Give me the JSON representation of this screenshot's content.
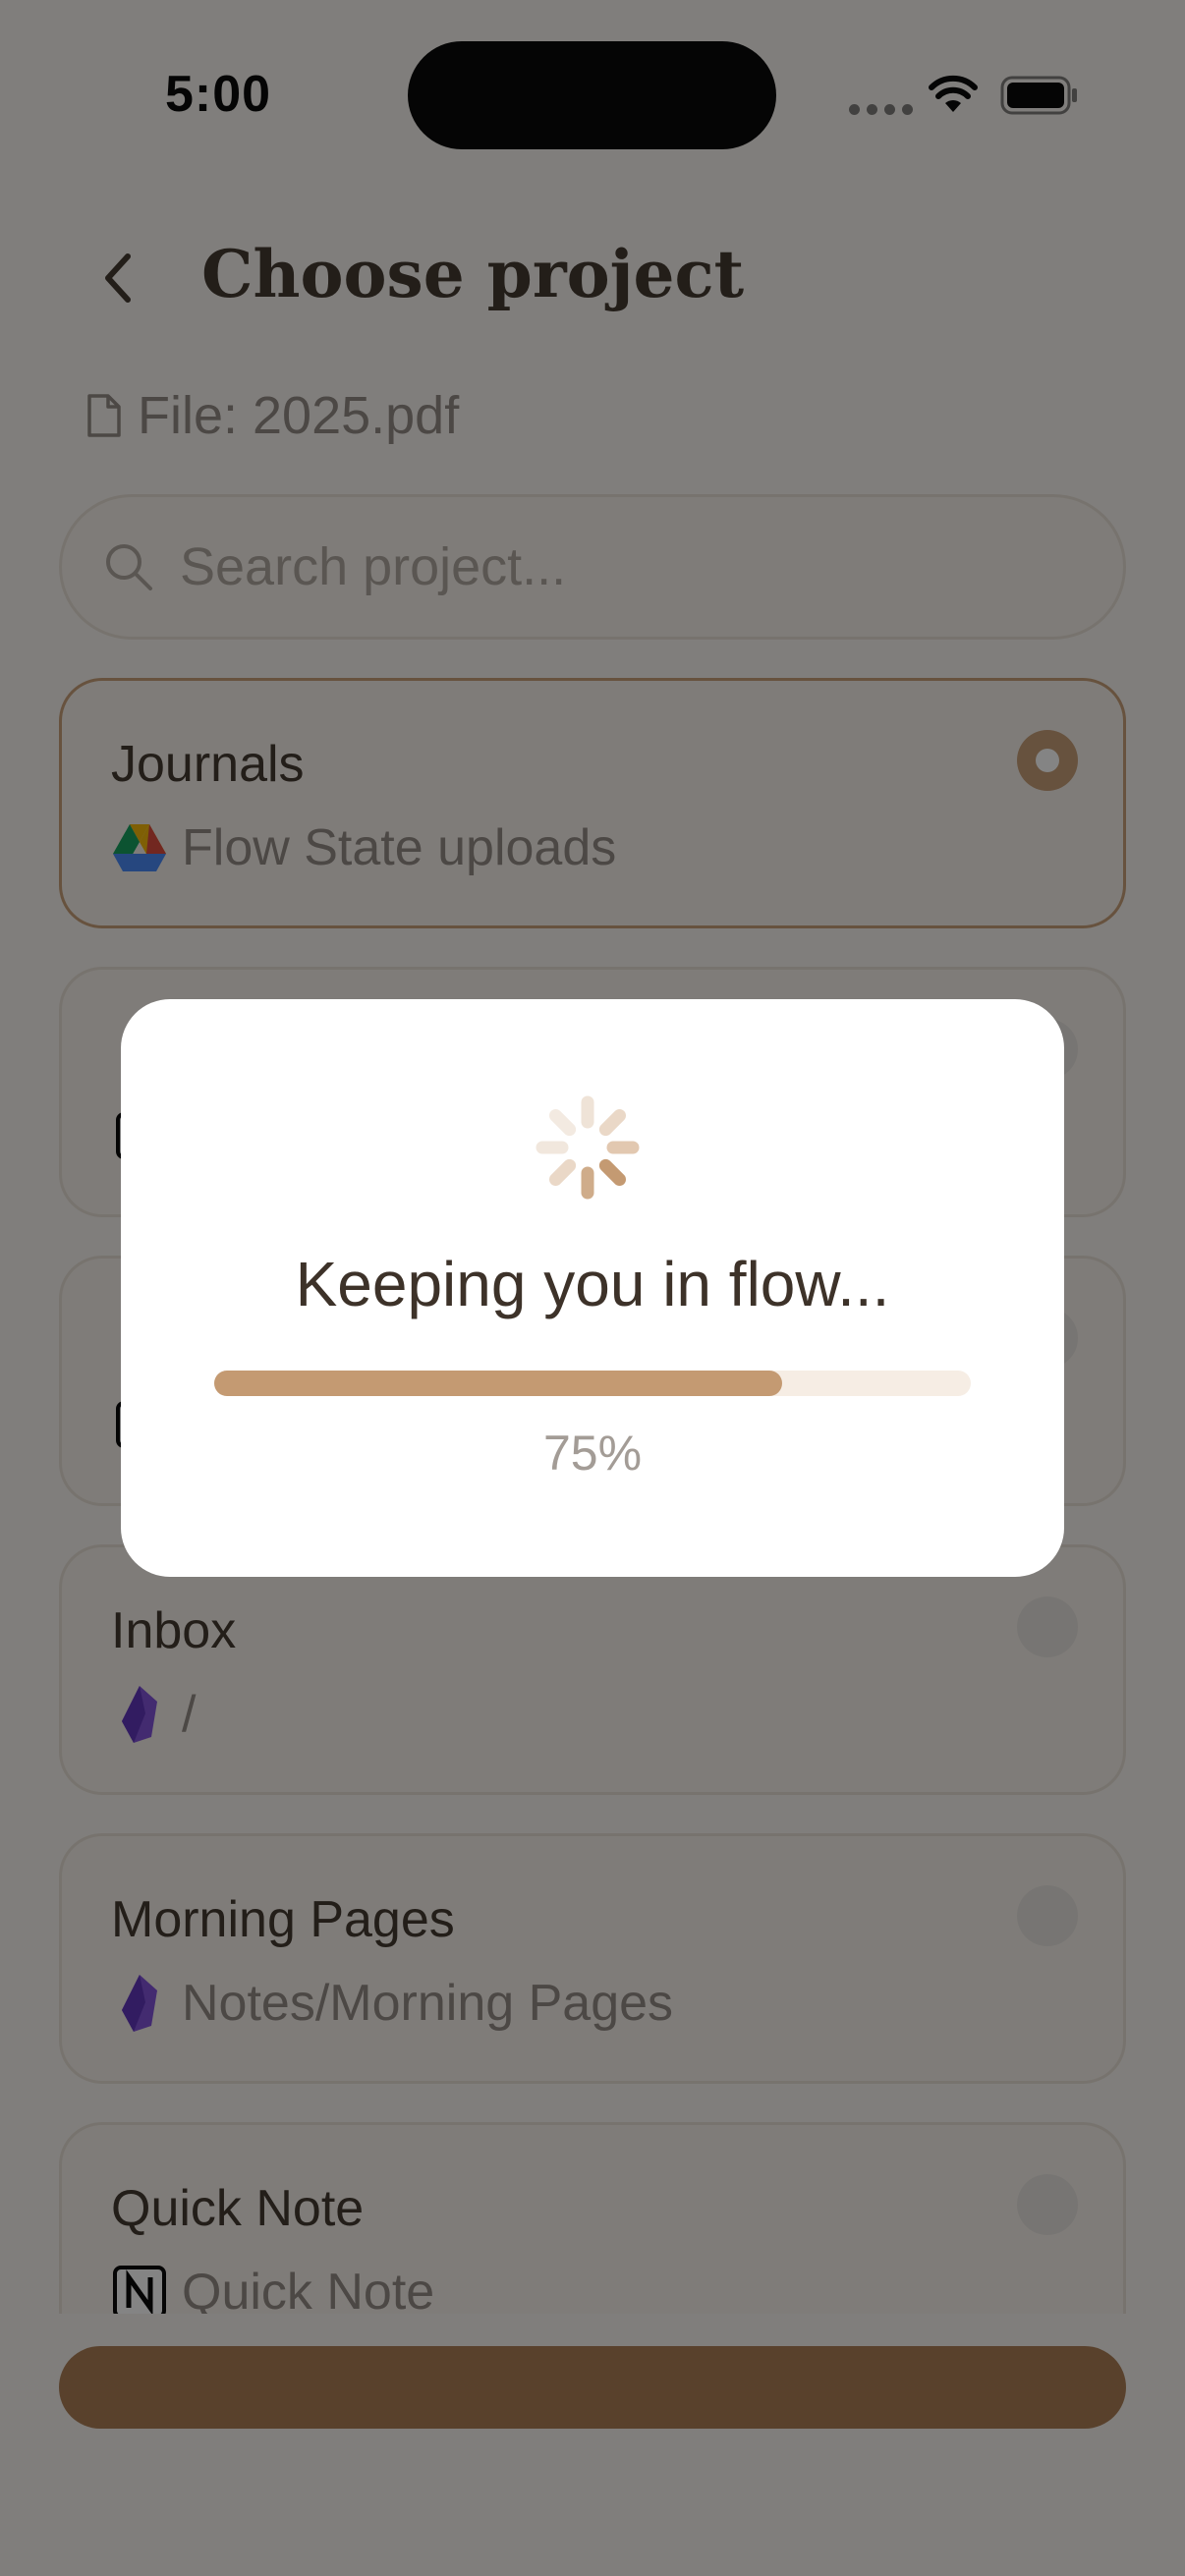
{
  "status_bar": {
    "time": "5:00"
  },
  "header": {
    "title": "Choose project",
    "file_label": "File: 2025.pdf"
  },
  "search": {
    "placeholder": "Search project..."
  },
  "projects": [
    {
      "title": "Journals",
      "subtitle": "Flow State uploads",
      "source_icon": "google-drive-icon",
      "selected": true
    },
    {
      "title": "",
      "subtitle": "",
      "source_icon": "notion-icon",
      "selected": false
    },
    {
      "title": "",
      "subtitle": "",
      "source_icon": "notion-icon",
      "selected": false
    },
    {
      "title": "Inbox",
      "subtitle": "/",
      "source_icon": "obsidian-icon",
      "selected": false
    },
    {
      "title": "Morning Pages",
      "subtitle": "Notes/Morning Pages",
      "source_icon": "obsidian-icon",
      "selected": false
    },
    {
      "title": "Quick Note",
      "subtitle": "Quick Note",
      "source_icon": "notion-icon",
      "selected": false
    }
  ],
  "modal": {
    "title": "Keeping you in flow...",
    "progress": 0.75,
    "progress_text": "75%"
  },
  "colors": {
    "accent": "#c49a72",
    "background": "#f7f3ee",
    "text": "#3d3229"
  }
}
